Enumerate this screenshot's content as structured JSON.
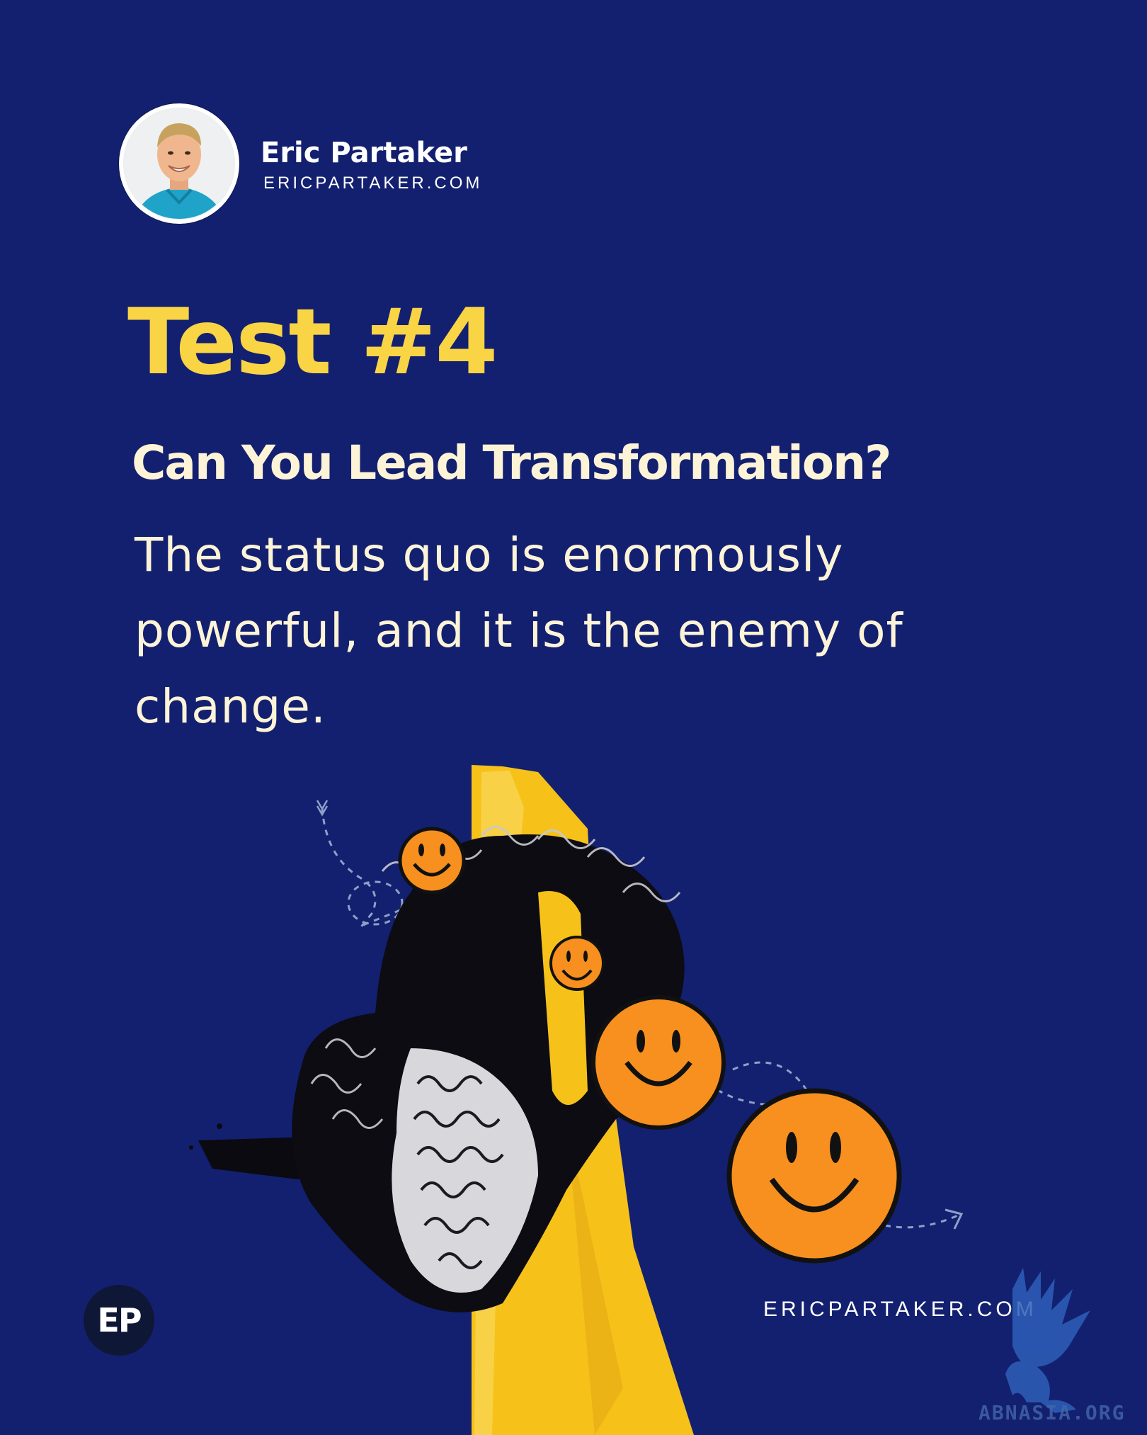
{
  "author": {
    "name": "Eric Partaker",
    "site": "ERICPARTAKER.COM"
  },
  "headline": {
    "title": "Test #4",
    "subtitle": "Can You Lead Transformation?",
    "body": "The status quo is enormously powerful, and it is the enemy of change."
  },
  "footer": {
    "logo_text": "EP",
    "site": "ERICPARTAKER.COM",
    "watermark": "ABNASIA.ORG"
  },
  "colors": {
    "background": "#132070",
    "title": "#f9d444",
    "text": "#fdf4d7",
    "smiley": "#f7901e",
    "tape": "#f6c21a"
  },
  "icons": {
    "avatar": "author-photo",
    "illustration": "statue-head-with-smileys",
    "watermark": "griffin-icon"
  }
}
